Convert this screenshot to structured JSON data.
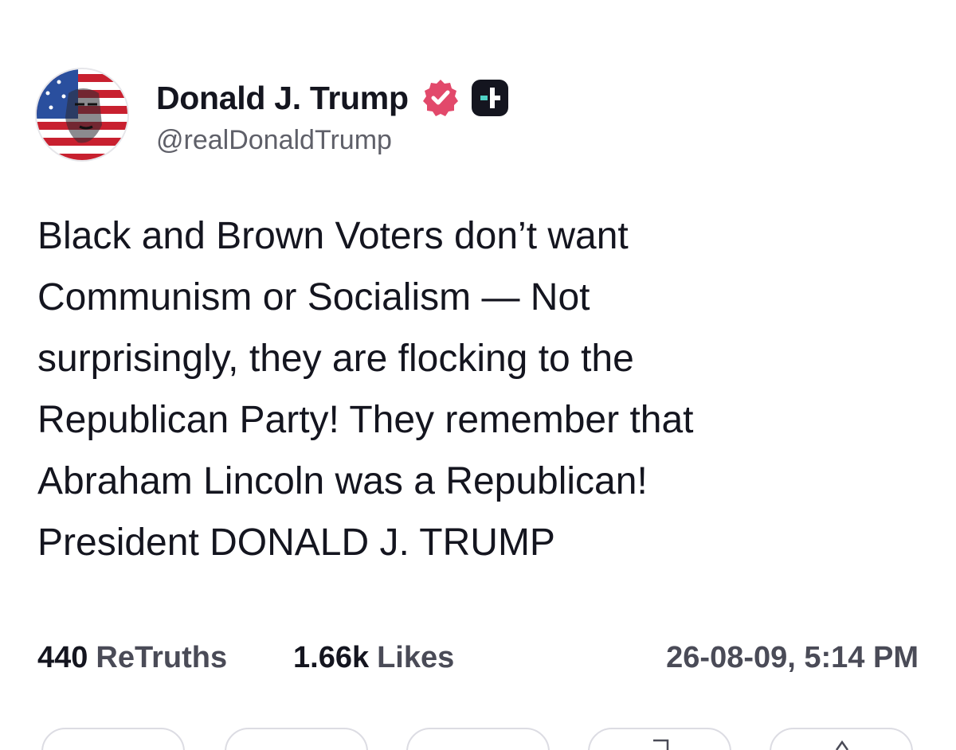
{
  "author": {
    "display_name": "Donald J. Trump",
    "handle": "@realDonaldTrump",
    "avatar_icon": "flag-portrait-avatar",
    "verified_icon": "verified-badge-icon",
    "plus_icon": "plus-badge-icon"
  },
  "post": {
    "text": "Black and Brown Voters don’t want\nCommunism or Socialism — Not\nsurprisingly, they are flocking to the\nRepublican Party! They remember that\nAbraham Lincoln was a Republican!\nPresident DONALD J. TRUMP"
  },
  "stats": {
    "retruths_count": "440",
    "retruths_label": "ReTruths",
    "likes_count": "1.66k",
    "likes_label": "Likes",
    "timestamp": "26-08-09, 5:14 PM"
  },
  "actions": [
    "reply-icon",
    "retruth-icon",
    "like-icon",
    "bookmark-icon",
    "share-icon"
  ],
  "colors": {
    "verified": "#e2496b",
    "plus_badge": "#14151f",
    "plus_accent": "#4fd1c5",
    "text": "#14151f",
    "muted": "#5f6069"
  }
}
